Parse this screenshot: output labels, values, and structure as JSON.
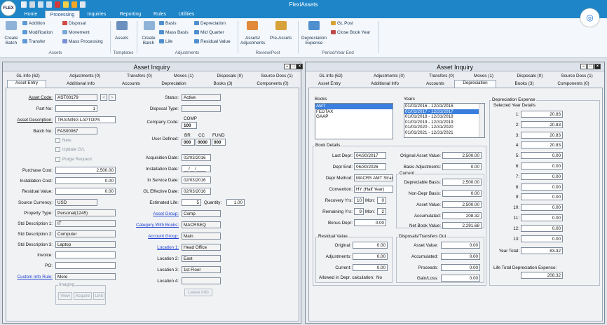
{
  "app": {
    "title": "FlexiAssets",
    "logo": "FLEX"
  },
  "ribbon": {
    "tabs": [
      "Home",
      "Processing",
      "Inquiries",
      "Reporting",
      "Rules",
      "Utilities"
    ],
    "groups": {
      "assets": "Assets",
      "templates": "Templates",
      "adjustments": "Adjustments",
      "review_post": "Review/Post",
      "period": "Period/Year End"
    },
    "create_batch": "Create Batch",
    "addition": "Addition",
    "modification": "Modification",
    "transfer": "Transfer",
    "disposal": "Disposal",
    "movement": "Movement",
    "mass_processing": "Mass Processing",
    "assets_btn": "Assets",
    "basis": "Basis",
    "mass_basis": "Mass Basis",
    "life": "Life",
    "depreciation": "Depreciation",
    "mid_quarter": "Mid Quarter",
    "residual_value": "Residual Value",
    "assets_adjustments": "Assets/ Adjustments",
    "pre_assets": "Pre-Assets",
    "depreciation_expense": "Depreciation Expense",
    "gl_post": "GL Post",
    "close_book_year": "Close Book Year"
  },
  "left": {
    "title": "Asset Inquiry",
    "tabs_row1": [
      "GL Info (62)",
      "Adjustments (0)",
      "Transfers (0)",
      "Moves (1)",
      "Disposals (0)",
      "Source Docs (1)"
    ],
    "tabs_row2": [
      "Asset Entry",
      "Additional Info",
      "Accounts",
      "Depreciation",
      "Books (3)",
      "Components (0)"
    ],
    "asset_code_label": "Asset Code:",
    "asset_code": "AST00179",
    "part_no_label": "Part No:",
    "part_no": "1",
    "asset_desc_label": "Asset Description:",
    "asset_desc": "TRAINING LAPTOPS",
    "batch_no_label": "Batch No:",
    "batch_no": "FAS00067",
    "new": "New",
    "update_gl": "Update G/L",
    "purge": "Purge Request",
    "purchase_cost_label": "Purchase Cost:",
    "purchase_cost": "2,500.00",
    "install_cost_label": "Installation Cost:",
    "install_cost": "0.00",
    "residual_label": "Residual Value:",
    "residual": "0.00",
    "source_currency_label": "Source Currency:",
    "source_currency": "USD",
    "property_type_label": "Property Type:",
    "property_type": "Personal(1245)",
    "std1_label": "Std Description 1:",
    "std1": "IT",
    "std2_label": "Std Description 2:",
    "std2": "Computer",
    "std3_label": "Std Description 3:",
    "std3": "Laptop",
    "invoice_label": "Invoice:",
    "po_label": "PO:",
    "custom_info_label": "Custom Info Rule:",
    "custom_info": "More",
    "imaging": "Imaging",
    "view": "View",
    "acquire": "Acquire",
    "link": "Link",
    "status_label": "Status:",
    "status": "Active",
    "disposal_type_label": "Disposal Type:",
    "company_code_label": "Company Code:",
    "company_code_hdr": "COMP",
    "company_code": "100",
    "user_defined_label": "User Defined:",
    "ud_hdr": [
      "BR",
      "CC",
      "FUND"
    ],
    "ud_vals": [
      "000",
      "0000",
      "000"
    ],
    "acq_date_label": "Acquisition Date:",
    "acq_date": "02/03/2016",
    "install_date_label": "Installation Date:",
    "install_date": "__/__/____",
    "in_service_label": "In Service Date:",
    "in_service": "02/03/2016",
    "gl_eff_label": "GL Effective Date:",
    "gl_eff": "02/03/2016",
    "est_life_label": "Estimated Life:",
    "est_life": "5",
    "quantity_label": "Quantity:",
    "quantity": "1.00",
    "asset_group_label": "Asset Group:",
    "asset_group": "Comp",
    "cat_books_label": "Category With Books:",
    "cat_books": "MACRSEQ",
    "account_group_label": "Account Group:",
    "account_group": "Main",
    "loc1_label": "Location 1:",
    "loc1": "Head Office",
    "loc2_label": "Location 2:",
    "loc2": "East",
    "loc3_label": "Location 3:",
    "loc3": "1st Floor",
    "loc4_label": "Location 4:",
    "lease_info": "Lease Info"
  },
  "right": {
    "title": "Asset Inquiry",
    "tabs_row1": [
      "GL Info (62)",
      "Adjustments (0)",
      "Transfers (0)",
      "Moves (1)",
      "Disposals (0)",
      "Source Docs (1)"
    ],
    "tabs_row2": [
      "Asset Entry",
      "Additional Info",
      "Accounts",
      "Depreciation",
      "Books (3)",
      "Components (0)"
    ],
    "books_label": "Books",
    "books": [
      "AMT",
      "FEDTAX",
      "GAAP"
    ],
    "years_label": "Years",
    "years": [
      "01/01/2016 - 12/31/2016",
      "01/01/2017 - 12/31/2017",
      "01/01/2018 - 12/31/2018",
      "01/01/2019 - 12/31/2019",
      "01/01/2020 - 12/31/2020",
      "01/01/2021 - 12/31/2021"
    ],
    "dep_exp_label": "Depreciation Expense",
    "sel_year_details": "Selected Year Details",
    "dep_lines": [
      {
        "n": "1:",
        "v": "20.83"
      },
      {
        "n": "2:",
        "v": "20.83"
      },
      {
        "n": "3:",
        "v": "20.83"
      },
      {
        "n": "4:",
        "v": "20.83"
      },
      {
        "n": "5:",
        "v": "0.00"
      },
      {
        "n": "6:",
        "v": "0.00"
      },
      {
        "n": "7:",
        "v": "0.00"
      },
      {
        "n": "8:",
        "v": "0.00"
      },
      {
        "n": "9:",
        "v": "0.00"
      },
      {
        "n": "10:",
        "v": "0.00"
      },
      {
        "n": "11:",
        "v": "0.00"
      },
      {
        "n": "12:",
        "v": "0.00"
      },
      {
        "n": "13:",
        "v": "0.00"
      }
    ],
    "year_total_label": "Year Total:",
    "year_total": "83.32",
    "life_total_label": "Life Total Depreciation Expense:",
    "life_total": "208.32",
    "book_details": "Book Details",
    "last_depr_label": "Last Depr:",
    "last_depr": "04/30/2017",
    "depr_end_label": "Depr End:",
    "depr_end": "06/30/2026",
    "depr_method_label": "Depr Method:",
    "depr_method": "MACRS AMT Straig",
    "convention_label": "Convention:",
    "convention": "HY (Half Year)",
    "recovery_label": "Recovery Yrs:",
    "recovery_yrs": "10",
    "mon_label": "Mon:",
    "recovery_mon": "0",
    "remaining_label": "Remaining Yrs:",
    "remaining_yrs": "9",
    "remaining_mon": "2",
    "bonus_label": "Bonus Depr:",
    "bonus": "0.00",
    "orig_value_label": "Original Asset Value:",
    "orig_value": "2,500.00",
    "basis_adj_label": "Basis Adjustments:",
    "basis_adj": "0.00",
    "current_label": "Current",
    "dep_basis_label": "Depreciable Basis:",
    "dep_basis": "2,500.00",
    "non_dep_label": "Non-Depr Basis:",
    "non_dep": "0.00",
    "asset_value_label": "Asset Value:",
    "asset_value": "2,500.00",
    "accumulated_label": "Accumulated:",
    "accumulated": "208.32",
    "nbv_label": "Net Book Value:",
    "nbv": "2,291.68",
    "residual_box": "Residual Value",
    "original_label": "Original:",
    "original": "0.00",
    "adjustments_label": "Adjustments:",
    "adjustments": "0.00",
    "current_rv_label": "Current:",
    "current_rv": "0.00",
    "allowed_label": "Allowed in Depr. calculation:",
    "allowed": "No",
    "disp_box": "Disposals/Transfers Out",
    "d_asset_value": "0.00",
    "d_accumulated": "0.00",
    "proceeds_label": "Proceeds:",
    "proceeds": "0.00",
    "gainloss_label": "Gain/Loss:",
    "gainloss": "0.00"
  },
  "colors": {
    "accent": "#1e86c8",
    "selection": "#3a7fdd",
    "link": "#1a3fd1"
  }
}
